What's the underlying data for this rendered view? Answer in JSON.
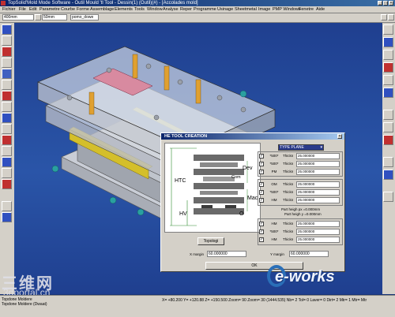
{
  "window": {
    "title": "TopSolid'Mold Mode Software - Outil Mould 'tl Tool - Dessin(1) (Outil)(#) - [Accolades mold]",
    "controls": [
      "_",
      "□",
      "×"
    ]
  },
  "menu": {
    "items": [
      "Fichier",
      "File",
      "Edit",
      "Parametre",
      "Courbe",
      "Forme",
      "Assemblage",
      "Elements",
      "Tools",
      "Window",
      "Analyse",
      "Reper",
      "Programme",
      "Usinage",
      "Sheetmetal",
      "Image",
      "PMP Windows",
      "Fenetre",
      "Aide"
    ]
  },
  "toolbar": {
    "field1": "400mm",
    "field2": "50mm",
    "field3": "pomo_dowe"
  },
  "dialog": {
    "title": "HE TOOL CREATION",
    "dropdown": "TYPE PLANE",
    "diagram_labels": {
      "htc": "HTC",
      "dev": "Dev",
      "com": "Com",
      "mac": "Mac",
      "hv": "HV",
      "o": "O"
    },
    "topology_button": "Topologi",
    "rows": [
      {
        "check": "✓",
        "label": "*500*",
        "name": "Thickn",
        "value": "25.000000"
      },
      {
        "check": "✓",
        "label": "*500*",
        "name": "Thickn",
        "value": "25.000000"
      },
      {
        "check": "✓",
        "label": "PM",
        "name": "Thickn",
        "value": "25.000000"
      },
      {
        "check": "✓",
        "label": "OM",
        "name": "Thickn",
        "value": "25.000000"
      },
      {
        "check": "✓",
        "label": "*500*",
        "name": "Thickn",
        "value": "25.000000"
      },
      {
        "check": "✓",
        "label": "HM",
        "name": "Thickn",
        "value": "25.000000"
      },
      {
        "check": "✓",
        "label": "HM",
        "name": "Thickn",
        "value": "25.000000"
      },
      {
        "check": "✓",
        "label": "*500*",
        "name": "Thickn",
        "value": "25.000000"
      },
      {
        "check": "✓",
        "label": "HM",
        "name": "Thickn",
        "value": "25.000000"
      }
    ],
    "part_height_1": "Part heigh px =0.000mm",
    "part_height_2": "Part heigh y =0.000mm",
    "xmargin_label": "X margin",
    "xmargin_value": "60.000000",
    "ymargin_label": "Y margin",
    "ymargin_value": "60.000000",
    "ok_button": "OK"
  },
  "statusbar": {
    "left_top": "Topdone Moldere",
    "left_bottom": "Topdone Moldere (Dwaat)",
    "coords": "X= +80.200   Y= +120.88   Z= +150.500   Zoom= 90   Zoom= 30   (1444.535)   Nb= 2   Tol= 0   Laver= 0   Dirt= 2   Mtr= 1   Mtr= Mtr"
  },
  "watermark": {
    "cn_logo": "三维网",
    "cn_url": "3dportal.cn",
    "eworks": "e-works"
  },
  "colors": {
    "viewport_bg": "#1f3f8f",
    "titlebar": "#0a246a",
    "dialog_bg": "#d4d0c8",
    "yellow_part": "#e8d23a",
    "eworks_blue": "#2a6fb8"
  }
}
